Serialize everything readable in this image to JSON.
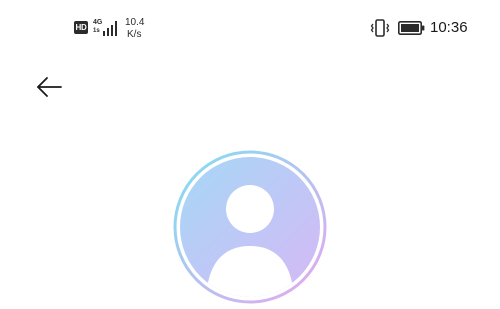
{
  "status_bar": {
    "hd_label": "HD",
    "network_type": "4G",
    "network_sub": "1s",
    "speed_value": "10.4",
    "speed_unit": "K/s",
    "time": "10:36"
  },
  "icons": {
    "hd": "hd-icon",
    "signal": "signal-bars-icon",
    "vibrate": "vibrate-icon",
    "battery": "battery-icon",
    "back": "arrow-left-icon",
    "avatar": "user-avatar-icon"
  },
  "colors": {
    "avatar_gradient_start": "#a6d8f7",
    "avatar_gradient_end": "#d6b8f5",
    "ring_start": "#7ee0f2",
    "ring_end": "#e9a6ee"
  }
}
